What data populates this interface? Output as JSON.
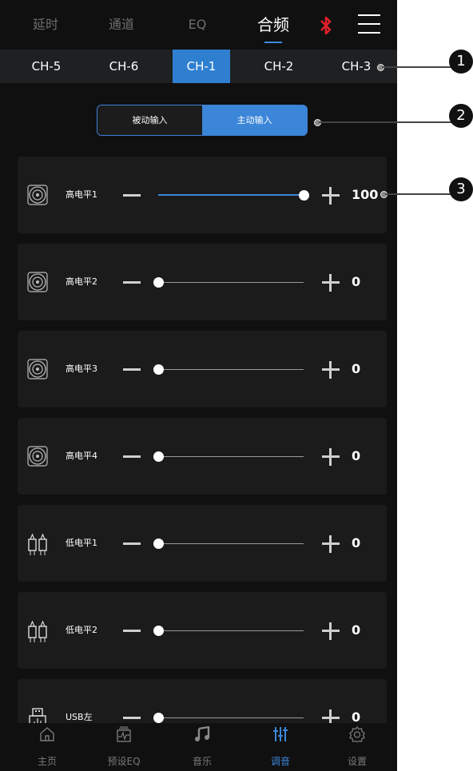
{
  "top_tabs": [
    {
      "label": "延时"
    },
    {
      "label": "通道"
    },
    {
      "label": "EQ"
    },
    {
      "label": "合频"
    }
  ],
  "top_tabs_active": "合频",
  "channels": [
    {
      "label": "CH-5"
    },
    {
      "label": "CH-6"
    },
    {
      "label": "CH-1"
    },
    {
      "label": "CH-2"
    },
    {
      "label": "CH-3"
    }
  ],
  "channel_active": "CH-1",
  "input_mode": {
    "passive_label": "被动输入",
    "active_label": "主动输入",
    "selected": "主动输入"
  },
  "sliders": [
    {
      "label": "高电平1",
      "value": "100",
      "fraction": 1.0,
      "icon": "speaker-icon"
    },
    {
      "label": "高电平2",
      "value": "0",
      "fraction": 0.0,
      "icon": "speaker-icon"
    },
    {
      "label": "高电平3",
      "value": "0",
      "fraction": 0.0,
      "icon": "speaker-icon"
    },
    {
      "label": "高电平4",
      "value": "0",
      "fraction": 0.0,
      "icon": "speaker-icon"
    },
    {
      "label": "低电平1",
      "value": "0",
      "fraction": 0.0,
      "icon": "rca-plug-icon"
    },
    {
      "label": "低电平2",
      "value": "0",
      "fraction": 0.0,
      "icon": "rca-plug-icon"
    },
    {
      "label": "USB左",
      "value": "0",
      "fraction": 0.0,
      "icon": "usb-icon"
    }
  ],
  "bottom_nav": [
    {
      "label": "主页",
      "icon": "home-icon"
    },
    {
      "label": "预设EQ",
      "icon": "preset-eq-icon"
    },
    {
      "label": "音乐",
      "icon": "music-icon"
    },
    {
      "label": "调音",
      "icon": "mixer-icon"
    },
    {
      "label": "设置",
      "icon": "settings-icon"
    }
  ],
  "bottom_nav_active": "调音",
  "annotations": [
    "1",
    "2",
    "3"
  ],
  "colors": {
    "accent": "#3b86d9",
    "background": "#101010",
    "card": "#1b1b1b",
    "bluetooth": "#e0202b"
  }
}
